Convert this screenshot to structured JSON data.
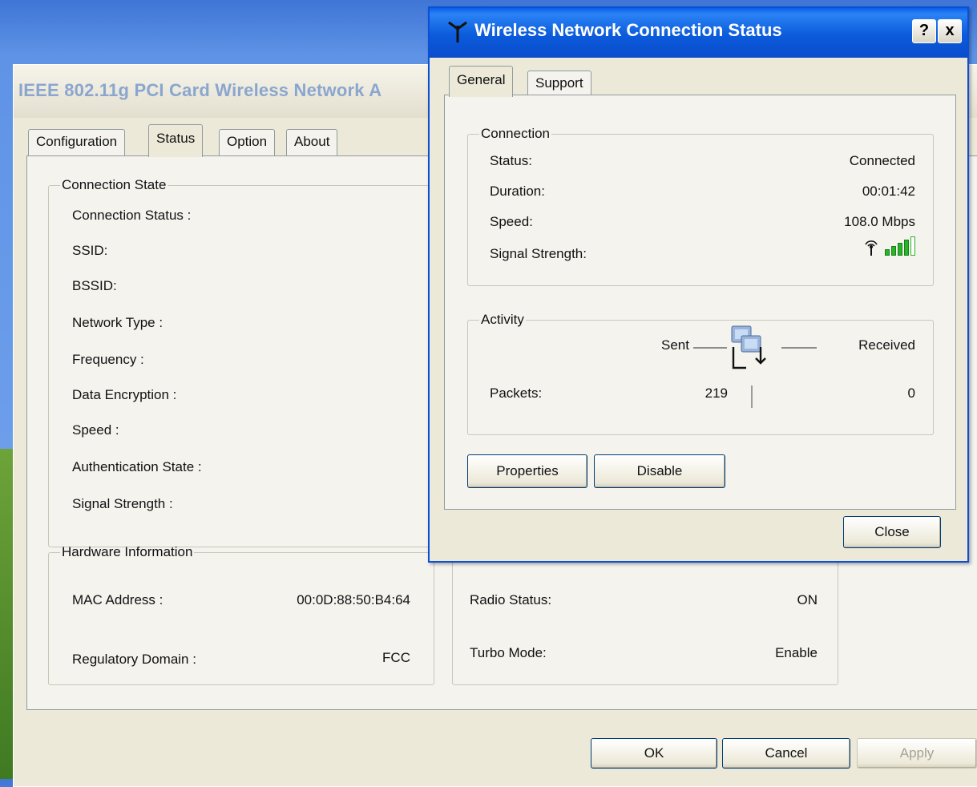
{
  "bg_window": {
    "title": "IEEE 802.11g PCI Card Wireless Network A",
    "tabs": [
      "Configuration",
      "Status",
      "Option",
      "About"
    ],
    "connection_state": {
      "legend": "Connection State",
      "labels": [
        "Connection Status :",
        "SSID:",
        "BSSID:",
        "Network Type :",
        "Frequency :",
        "Data Encryption :",
        "Speed :",
        "Authentication State :",
        "Signal Strength :"
      ]
    },
    "hardware": {
      "legend": "Hardware Information",
      "mac_label": "MAC Address :",
      "mac_value": "00:0D:88:50:B4:64",
      "reg_label": "Regulatory Domain :",
      "reg_value": "FCC",
      "radio_label": "Radio Status:",
      "radio_value": "ON",
      "turbo_label": "Turbo Mode:",
      "turbo_value": "Enable"
    },
    "buttons": {
      "ok": "OK",
      "cancel": "Cancel",
      "apply": "Apply"
    }
  },
  "dialog": {
    "title": "Wireless Network Connection Status",
    "help_label": "?",
    "close_x": "x",
    "tabs": [
      "General",
      "Support"
    ],
    "connection": {
      "legend": "Connection",
      "status_label": "Status:",
      "status_value": "Connected",
      "duration_label": "Duration:",
      "duration_value": "00:01:42",
      "speed_label": "Speed:",
      "speed_value": "108.0 Mbps",
      "signal_label": "Signal Strength:",
      "signal_level": 0.8
    },
    "activity": {
      "legend": "Activity",
      "sent": "Sent",
      "received": "Received",
      "packets_label": "Packets:",
      "packets_sent": "219",
      "packets_received": "0"
    },
    "buttons": {
      "properties": "Properties",
      "disable": "Disable",
      "close": "Close"
    }
  },
  "icons": {
    "antenna": "antenna-icon",
    "network_activity": "network-activity-icon",
    "signal": "signal-strength-icon"
  },
  "colors": {
    "titlebar": "#0a5ee8",
    "signal_green": "#28b428",
    "window_face": "#ece9d8"
  }
}
